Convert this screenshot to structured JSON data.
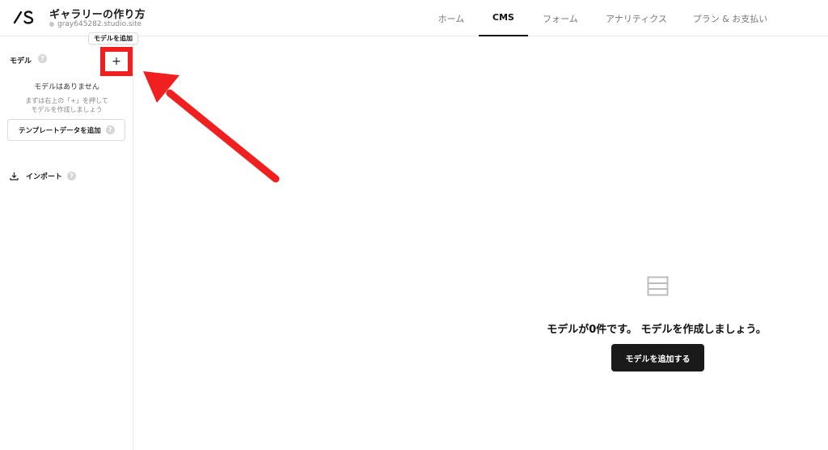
{
  "header": {
    "site_title": "ギャラリーの作り方",
    "site_url": "gray645282.studio.site",
    "nav": [
      "ホーム",
      "CMS",
      "フォーム",
      "アナリティクス",
      "プラン & お支払い"
    ],
    "active_nav": "CMS"
  },
  "sidebar": {
    "model_label": "モデル",
    "help_glyph": "?",
    "tooltip": "モデルを追加",
    "add_glyph": "+",
    "empty_title": "モデルはありません",
    "empty_sub": "まずは右上の「+」を押して\nモデルを作成しましょう",
    "template_button": "テンプレートデータを追加",
    "import_label": "インポート"
  },
  "main": {
    "empty_message": "モデルが0件です。 モデルを作成しましょう。",
    "add_button": "モデルを追加する"
  },
  "colors": {
    "highlight": "#f02020",
    "primary_button": "#1a1a1a"
  },
  "icons": {
    "logo": "studio-logo",
    "chevron": "chevron-down-icon",
    "empty_state": "list-icon",
    "import": "download-icon"
  }
}
